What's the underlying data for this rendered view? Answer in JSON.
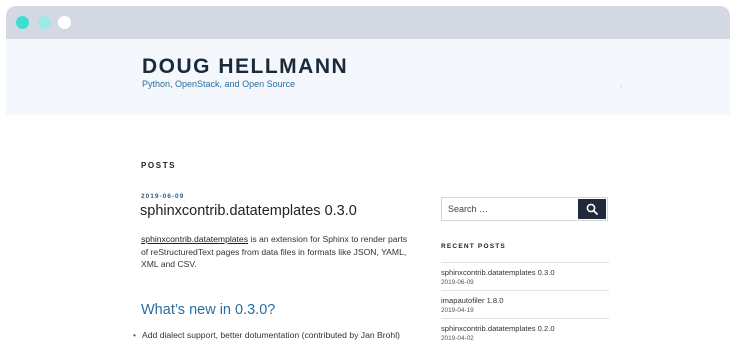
{
  "site": {
    "title": "DOUG HELLMANN",
    "description": "Python, OpenStack, and Open Source"
  },
  "main": {
    "section_label": "POSTS",
    "post": {
      "date": "2019-06-09",
      "title": "sphinxcontrib.datatemplates 0.3.0",
      "excerpt_link": "sphinxcontrib.datatemplates",
      "excerpt_text": " is an extension for Sphinx to render parts of reStructuredText pages from data files in formats like JSON, YAML, XML and CSV.",
      "section_heading": "What’s new in 0.3.0?",
      "bullets": [
        "Add dialect support, better dotumentation (contributed by Jan Brohl)"
      ]
    }
  },
  "sidebar": {
    "search": {
      "placeholder": "Search …",
      "button_icon": "search-icon"
    },
    "recent_heading": "RECENT POSTS",
    "recent_posts": [
      {
        "title": "sphinxcontrib.datatemplates 0.3.0",
        "date": "2019-06-09"
      },
      {
        "title": "imapautofiler 1.8.0",
        "date": "2019-04-19"
      },
      {
        "title": "sphinxcontrib.datatemplates 0.2.0",
        "date": "2019-04-02"
      }
    ]
  },
  "colors": {
    "accent": "#2a6ea0",
    "dark": "#1f2b3a",
    "header_bg": "#f4f7fb",
    "chrome_bg": "#d3d8e2"
  }
}
